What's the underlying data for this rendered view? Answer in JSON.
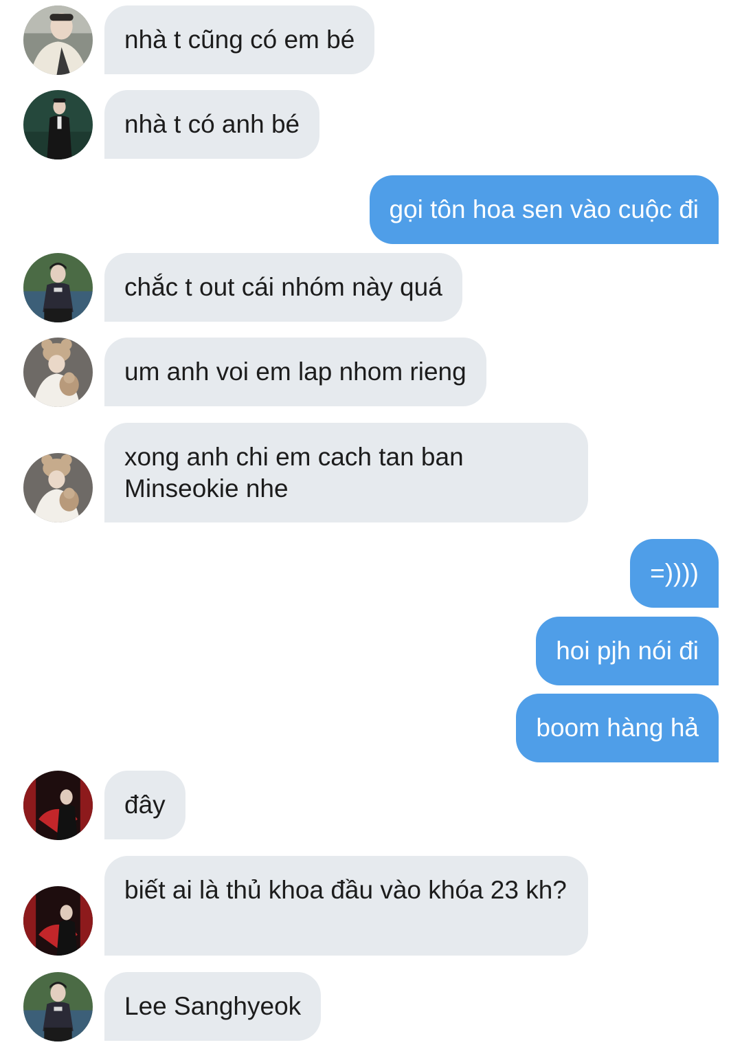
{
  "colors": {
    "incoming_bubble": "#e6eaee",
    "outgoing_bubble": "#4f9ee8",
    "incoming_text": "#1c1c1c",
    "outgoing_text": "#ffffff",
    "background": "#ffffff"
  },
  "messages": [
    {
      "direction": "in",
      "avatar": "avatar-cream-coat",
      "text": "nhà t cũng có em bé"
    },
    {
      "direction": "in",
      "avatar": "avatar-dark-suit-green",
      "text": "nhà t có anh bé"
    },
    {
      "direction": "out",
      "text": "gọi tôn hoa sen vào cuộc đi"
    },
    {
      "direction": "in",
      "avatar": "avatar-court-outdoor",
      "text": "chắc t out cái nhóm này quá"
    },
    {
      "direction": "in",
      "avatar": "avatar-bear-hat",
      "text": "um anh voi em lap nhom rieng"
    },
    {
      "direction": "in",
      "avatar": "avatar-bear-hat",
      "text": "xong anh chi em cach tan ban Minseokie nhe"
    },
    {
      "direction": "out",
      "text": "=))))"
    },
    {
      "direction": "out",
      "text": "hoi pjh nói đi"
    },
    {
      "direction": "out",
      "text": "boom hàng hả"
    },
    {
      "direction": "in",
      "avatar": "avatar-red-fan",
      "text": "đây"
    },
    {
      "direction": "in",
      "avatar": "avatar-red-fan",
      "text": "biết ai là thủ khoa đầu vào khóa 23 kh?"
    },
    {
      "direction": "in",
      "avatar": "avatar-court-outdoor",
      "text": "Lee Sanghyeok"
    }
  ]
}
